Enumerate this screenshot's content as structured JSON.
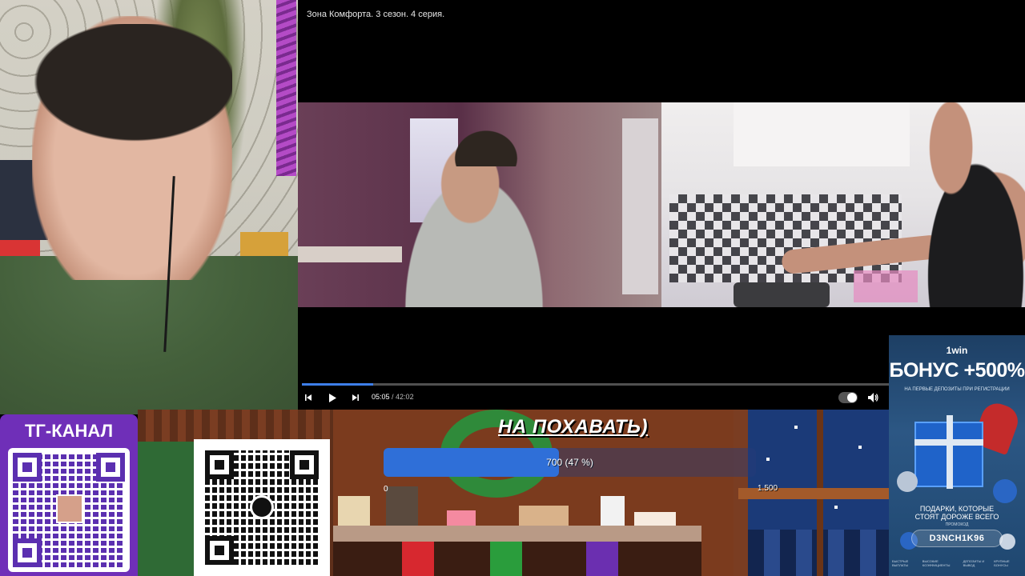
{
  "player": {
    "title": "Зона Комфорта. 3 сезон. 4 серия.",
    "current_time": "05:05",
    "separator": " / ",
    "duration": "42:02",
    "progress": 0.12,
    "accent": "#3d7ee8"
  },
  "controls": {
    "prev_icon": "skip-previous-icon",
    "play_icon": "play-icon",
    "next_icon": "skip-next-icon",
    "autoplay_icon": "autoplay-toggle-icon",
    "volume_icon": "volume-icon"
  },
  "donation_goal": {
    "headline": "НА ПОХАВАТЬ)",
    "progress_label": "700 (47 %)",
    "fraction": 0.47,
    "min": "0",
    "max": "1.500",
    "fill_color": "#2f6fd8"
  },
  "tg_card": {
    "title": "ТГ-КАНАЛ",
    "accent": "#6f2fb8"
  },
  "ad": {
    "brand": "1win",
    "bonus": "БОНУС +500%",
    "subtitle": "НА ПЕРВЫЕ ДЕПОЗИТЫ ПРИ РЕГИСТРАЦИИ",
    "gift_line1": "ПОДАРКИ, КОТОРЫЕ",
    "gift_line2": "СТОЯТ ДОРОЖЕ ВСЕГО",
    "promo_caption": "ПРОМОКОД",
    "promo_code": "D3NCH1K96",
    "footer": [
      "БЫСТРЫЕ ВЫПЛАТЫ",
      "ВЫСОКИЕ КОЭФФИЦИЕНТЫ",
      "ДЕПОЗИТЫ И ВЫВОД",
      "КРУПНЫЕ БОНУСЫ"
    ]
  }
}
